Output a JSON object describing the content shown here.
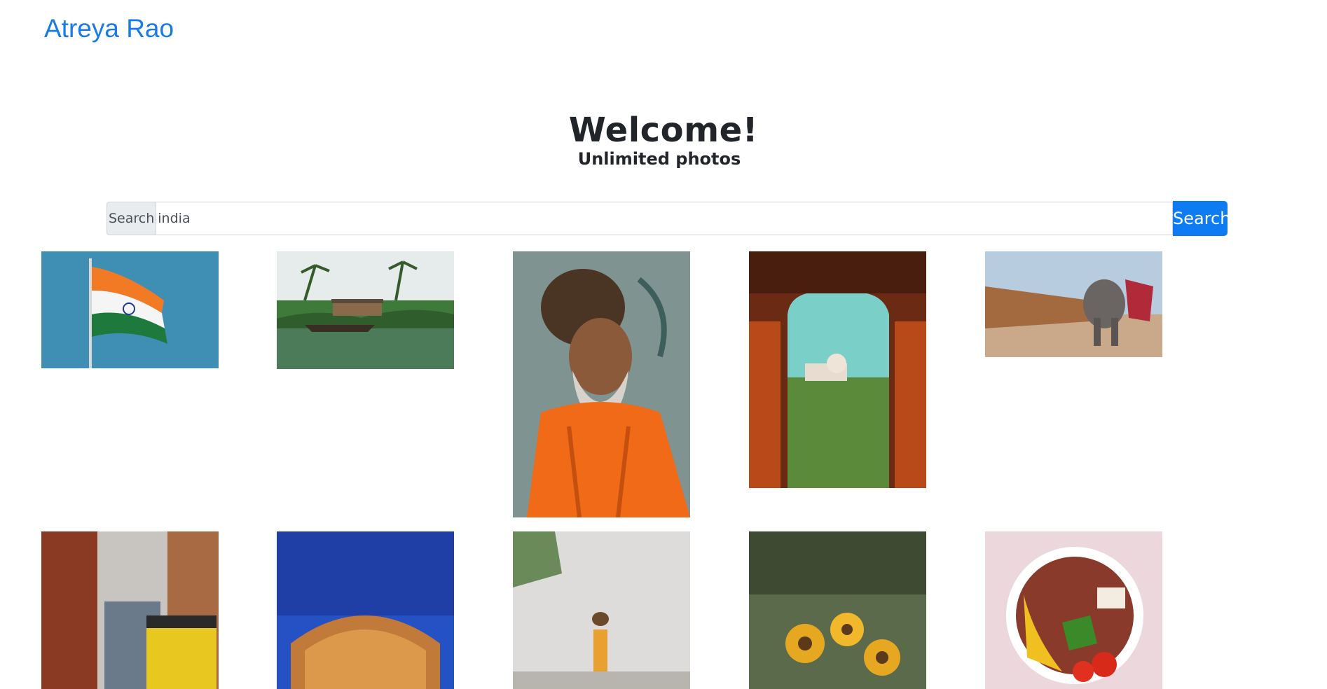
{
  "header": {
    "brand": "Atreya Rao"
  },
  "hero": {
    "title": "Welcome!",
    "subtitle": "Unlimited photos"
  },
  "search": {
    "prefix_label": "Search",
    "value": "india",
    "button_label": "Search"
  },
  "colors": {
    "brand": "#1a7be6",
    "button": "#0d7cf2"
  },
  "gallery": {
    "photos": [
      {
        "subject": "indian-flag"
      },
      {
        "subject": "houseboat-backwaters"
      },
      {
        "subject": "sadhu-portrait"
      },
      {
        "subject": "taj-mahal-through-arch"
      },
      {
        "subject": "elephant-at-fort"
      },
      {
        "subject": "rajasthan-street-rickshaw"
      },
      {
        "subject": "hawa-mahal-night"
      },
      {
        "subject": "woman-carrying-pot"
      },
      {
        "subject": "sunflowers"
      },
      {
        "subject": "food-bowl"
      }
    ]
  }
}
